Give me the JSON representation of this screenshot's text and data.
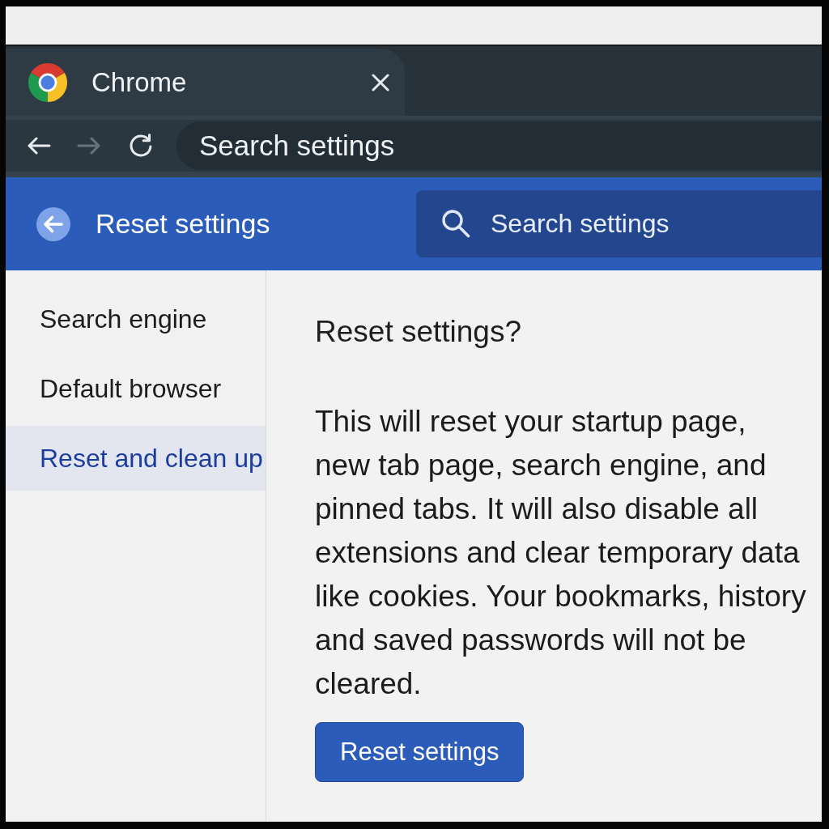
{
  "tab": {
    "title": "Chrome"
  },
  "toolbar": {
    "nav_buttons": [
      {
        "kind": "back",
        "disabled": false
      },
      {
        "kind": "forward",
        "disabled": true
      },
      {
        "kind": "reload",
        "disabled": false
      }
    ],
    "address_bar": {
      "value": "Search settings"
    }
  },
  "settings_header": {
    "title": "Reset settings",
    "search": {
      "placeholder": "Search settings"
    }
  },
  "sidebar": {
    "items": [
      {
        "label": "Search engine",
        "selected": false
      },
      {
        "label": "Default browser",
        "selected": false
      },
      {
        "label": "Reset and clean up",
        "selected": true
      }
    ]
  },
  "content": {
    "heading": "Reset settings?",
    "description": "This will reset your startup page,\nnew tab page, search engine, and\npinned tabs. It will also disable all\nextensions and clear temporary data\nlike cookies. Your bookmarks, history\nand saved passwords will not be\ncleared.",
    "button": "Reset settings"
  }
}
